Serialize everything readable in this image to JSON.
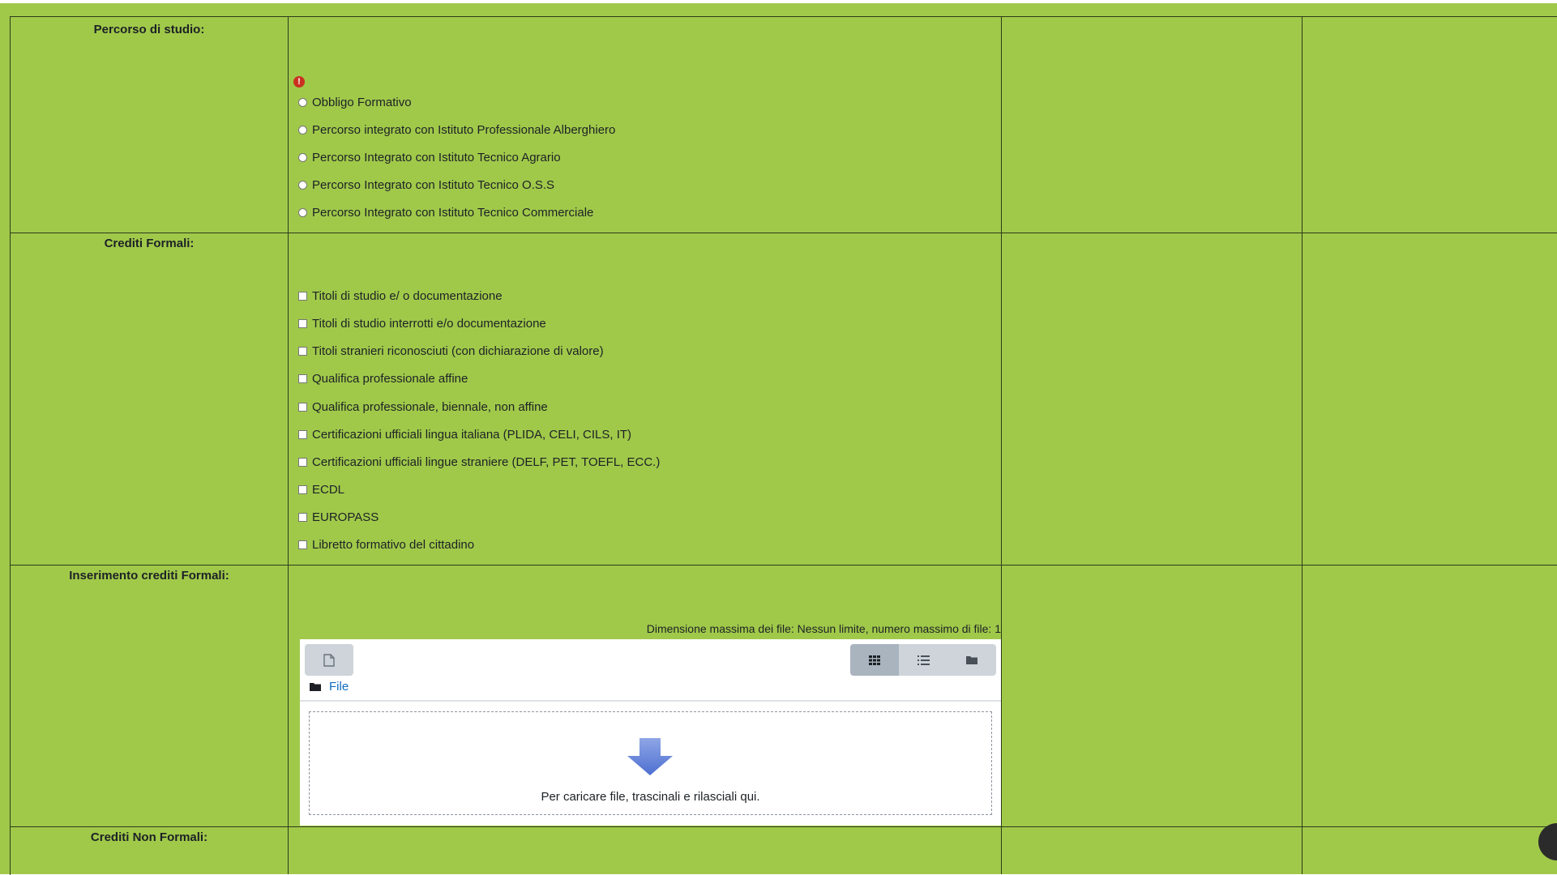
{
  "colors": {
    "background": "#a0c94a",
    "border": "#2d3a1a",
    "link": "#0f6cbf",
    "error": "#ca3120"
  },
  "rows": {
    "percorso": {
      "label": "Percorso di studio:",
      "error_icon": "exclamation-circle-icon",
      "options": [
        "Obbligo Formativo",
        "Percorso integrato con Istituto Professionale Alberghiero",
        "Percorso Integrato con Istituto Tecnico Agrario",
        "Percorso Integrato con Istituto Tecnico O.S.S",
        "Percorso Integrato con Istituto Tecnico Commerciale"
      ]
    },
    "crediti_formali": {
      "label": "Crediti Formali:",
      "options": [
        "Titoli di studio e/ o documentazione",
        "Titoli di studio interrotti e/o documentazione",
        "Titoli stranieri riconosciuti (con dichiarazione di valore)",
        "Qualifica professionale affine",
        "Qualifica professionale, biennale, non affine",
        "Certificazioni ufficiali lingua italiana (PLIDA, CELI, CILS, IT)",
        "Certificazioni ufficiali lingue straniere (DELF, PET, TOEFL, ECC.)",
        "ECDL",
        "EUROPASS",
        "Libretto formativo del cittadino"
      ]
    },
    "inserimento": {
      "label": "Inserimento crediti Formali:",
      "file_limit": "Dimensione massima dei file: Nessun limite, numero massimo di file: 1",
      "path_link": "File",
      "drop_text": "Per caricare file, trascinali e rilasciali qui.",
      "icons": [
        "file-icon",
        "grid-view-icon",
        "list-view-icon",
        "folder-view-icon",
        "folder-icon",
        "download-arrow-icon"
      ]
    },
    "crediti_non_formali": {
      "label": "Crediti Non Formali:"
    }
  }
}
